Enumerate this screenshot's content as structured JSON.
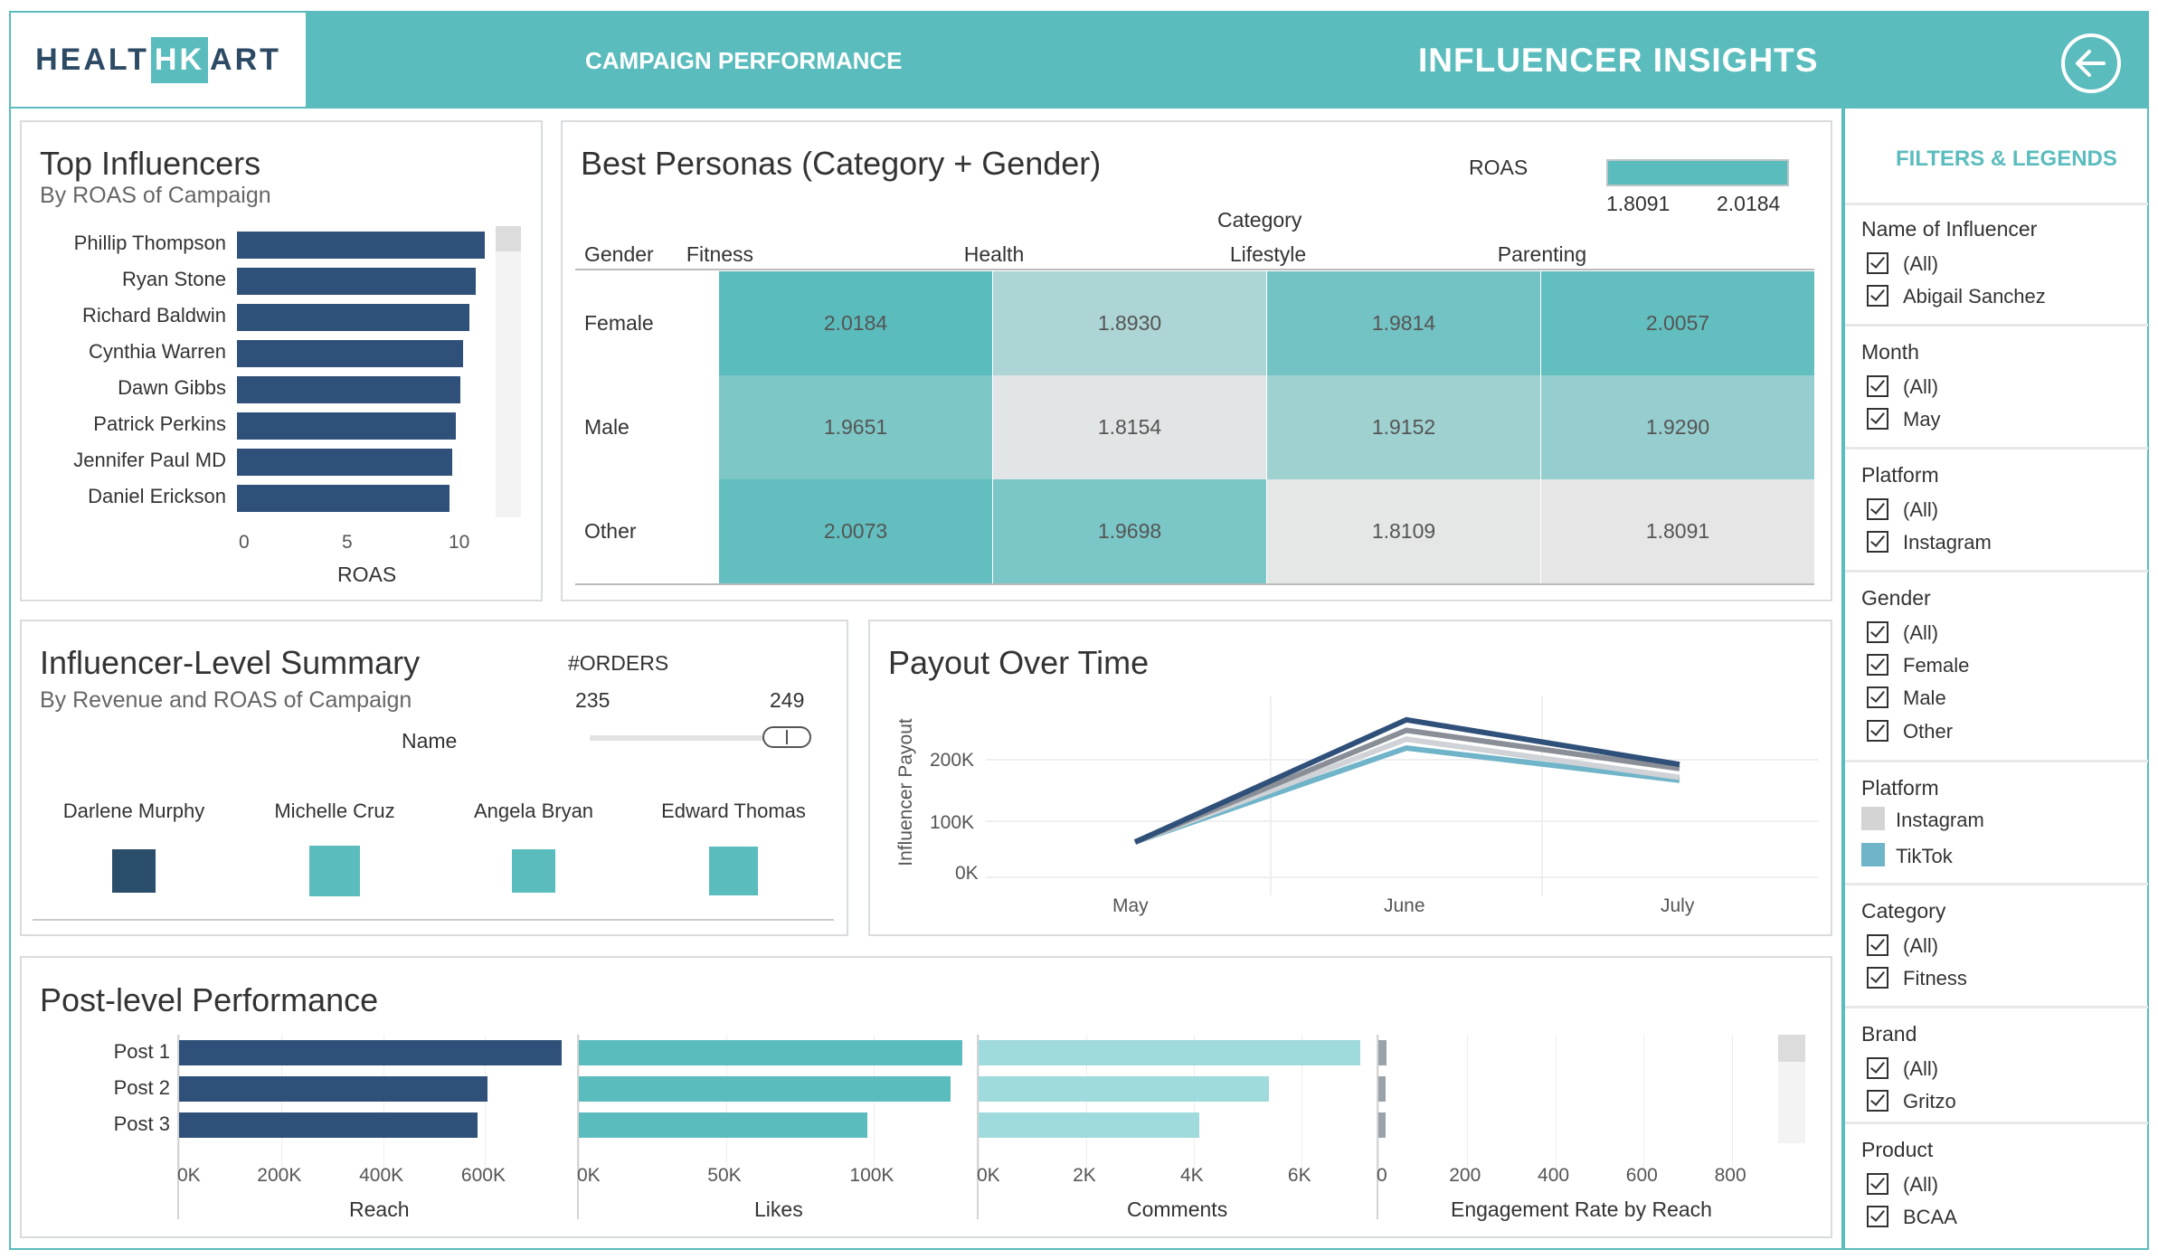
{
  "header": {
    "logo_left": "HEALT",
    "logo_mid": "HK",
    "logo_right": "ART",
    "nav_campaign": "CAMPAIGN PERFORMANCE",
    "nav_influencer": "INFLUENCER INSIGHTS",
    "back_icon": "arrow-left-circle-icon",
    "accent_color": "#5bbcbd"
  },
  "top_influencers": {
    "title": "Top Influencers",
    "subtitle": "By ROAS of Campaign",
    "xlabel": "ROAS",
    "ticks": [
      "0",
      "5",
      "10"
    ]
  },
  "personas": {
    "title": "Best Personas (Category + Gender)",
    "legend_title": "ROAS",
    "legend_min": "1.8091",
    "legend_max": "2.0184",
    "category_header": "Category",
    "gender_header": "Gender",
    "columns": [
      "Fitness",
      "Health",
      "Lifestyle",
      "Parenting"
    ],
    "rows": [
      {
        "label": "Female",
        "values": [
          "2.0184",
          "1.8930",
          "1.9814",
          "2.0057"
        ]
      },
      {
        "label": "Male",
        "values": [
          "1.9651",
          "1.8154",
          "1.9152",
          "1.9290"
        ]
      },
      {
        "label": "Other",
        "values": [
          "2.0073",
          "1.9698",
          "1.8109",
          "1.8091"
        ]
      }
    ]
  },
  "summary": {
    "title": "Influencer-Level Summary",
    "subtitle": "By Revenue and ROAS of Campaign",
    "orders_label": "#ORDERS",
    "orders_min": "235",
    "orders_max": "249",
    "name_label": "Name",
    "people": [
      "Darlene Murphy",
      "Michelle Cruz",
      "Angela Bryan",
      "Edward Thomas"
    ]
  },
  "payout": {
    "title": "Payout Over Time",
    "ylabel": "Influencer Payout",
    "yticks": [
      "200K",
      "100K",
      "0K"
    ],
    "months": [
      "May",
      "June",
      "July"
    ]
  },
  "posts": {
    "title": "Post-level Performance",
    "labels": [
      "Post 1",
      "Post 2",
      "Post 3"
    ],
    "reach_label": "Reach",
    "reach_ticks": [
      "0K",
      "200K",
      "400K",
      "600K"
    ],
    "likes_label": "Likes",
    "likes_ticks": [
      "0K",
      "50K",
      "100K"
    ],
    "comments_label": "Comments",
    "comments_ticks": [
      "0K",
      "2K",
      "4K",
      "6K"
    ],
    "er_label": "Engagement Rate by Reach",
    "er_ticks": [
      "0",
      "200",
      "400",
      "600",
      "800"
    ]
  },
  "filters": {
    "title": "FILTERS & LEGENDS",
    "influencer_title": "Name of Influencer",
    "influencer_opts": [
      "(All)",
      "Abigail Sanchez"
    ],
    "month_title": "Month",
    "month_opts": [
      "(All)",
      "May"
    ],
    "platform_title": "Platform",
    "platform_opts": [
      "(All)",
      "Instagram"
    ],
    "gender_title": "Gender",
    "gender_opts": [
      "(All)",
      "Female",
      "Male",
      "Other"
    ],
    "platform_legend_title": "Platform",
    "platform_legend": [
      "Instagram",
      "TikTok"
    ],
    "category_title": "Category",
    "category_opts": [
      "(All)",
      "Fitness"
    ],
    "brand_title": "Brand",
    "brand_opts": [
      "(All)",
      "Gritzo"
    ],
    "product_title": "Product",
    "product_opts": [
      "(All)",
      "BCAA"
    ]
  },
  "chart_data": [
    {
      "type": "bar",
      "title": "Top Influencers",
      "subtitle": "By ROAS of Campaign",
      "xlabel": "ROAS",
      "categories": [
        "Phillip Thompson",
        "Ryan Stone",
        "Richard Baldwin",
        "Cynthia Warren",
        "Dawn Gibbs",
        "Patrick Perkins",
        "Jennifer Paul MD",
        "Daniel Erickson"
      ],
      "values": [
        11.4,
        11.0,
        10.7,
        10.4,
        10.3,
        10.1,
        9.9,
        9.8
      ],
      "xlim": [
        0,
        12
      ],
      "color": "#2f5078"
    },
    {
      "type": "line",
      "title": "Payout Over Time",
      "ylabel": "Influencer Payout",
      "x": [
        "May",
        "June",
        "July"
      ],
      "ylim": [
        0,
        260000
      ],
      "series": [
        {
          "values": [
            60000,
            268000,
            192000
          ],
          "color": "#2f5078"
        },
        {
          "values": [
            60000,
            250000,
            185000
          ],
          "color": "#8a8f97"
        },
        {
          "values": [
            60000,
            235000,
            170000
          ],
          "color": "#cfd2d6"
        },
        {
          "values": [
            60000,
            220000,
            165000
          ],
          "color": "#6fb4c8"
        }
      ]
    },
    {
      "type": "bar",
      "title": "Post-level Performance",
      "categories": [
        "Post 1",
        "Post 2",
        "Post 3"
      ],
      "series": [
        {
          "name": "Reach",
          "values": [
            750000,
            605000,
            585000
          ],
          "max": 780000,
          "color": "#2f5078"
        },
        {
          "name": "Likes",
          "values": [
            130000,
            126000,
            98000
          ],
          "max": 135000,
          "color": "#5bbcbd"
        },
        {
          "name": "Comments",
          "values": [
            7100,
            5400,
            4100
          ],
          "max": 7400,
          "color": "#9fdbdc"
        },
        {
          "name": "Engagement Rate by Reach",
          "values": [
            18,
            14,
            12
          ],
          "max": 900,
          "color": "#9aa3aa"
        }
      ]
    }
  ]
}
